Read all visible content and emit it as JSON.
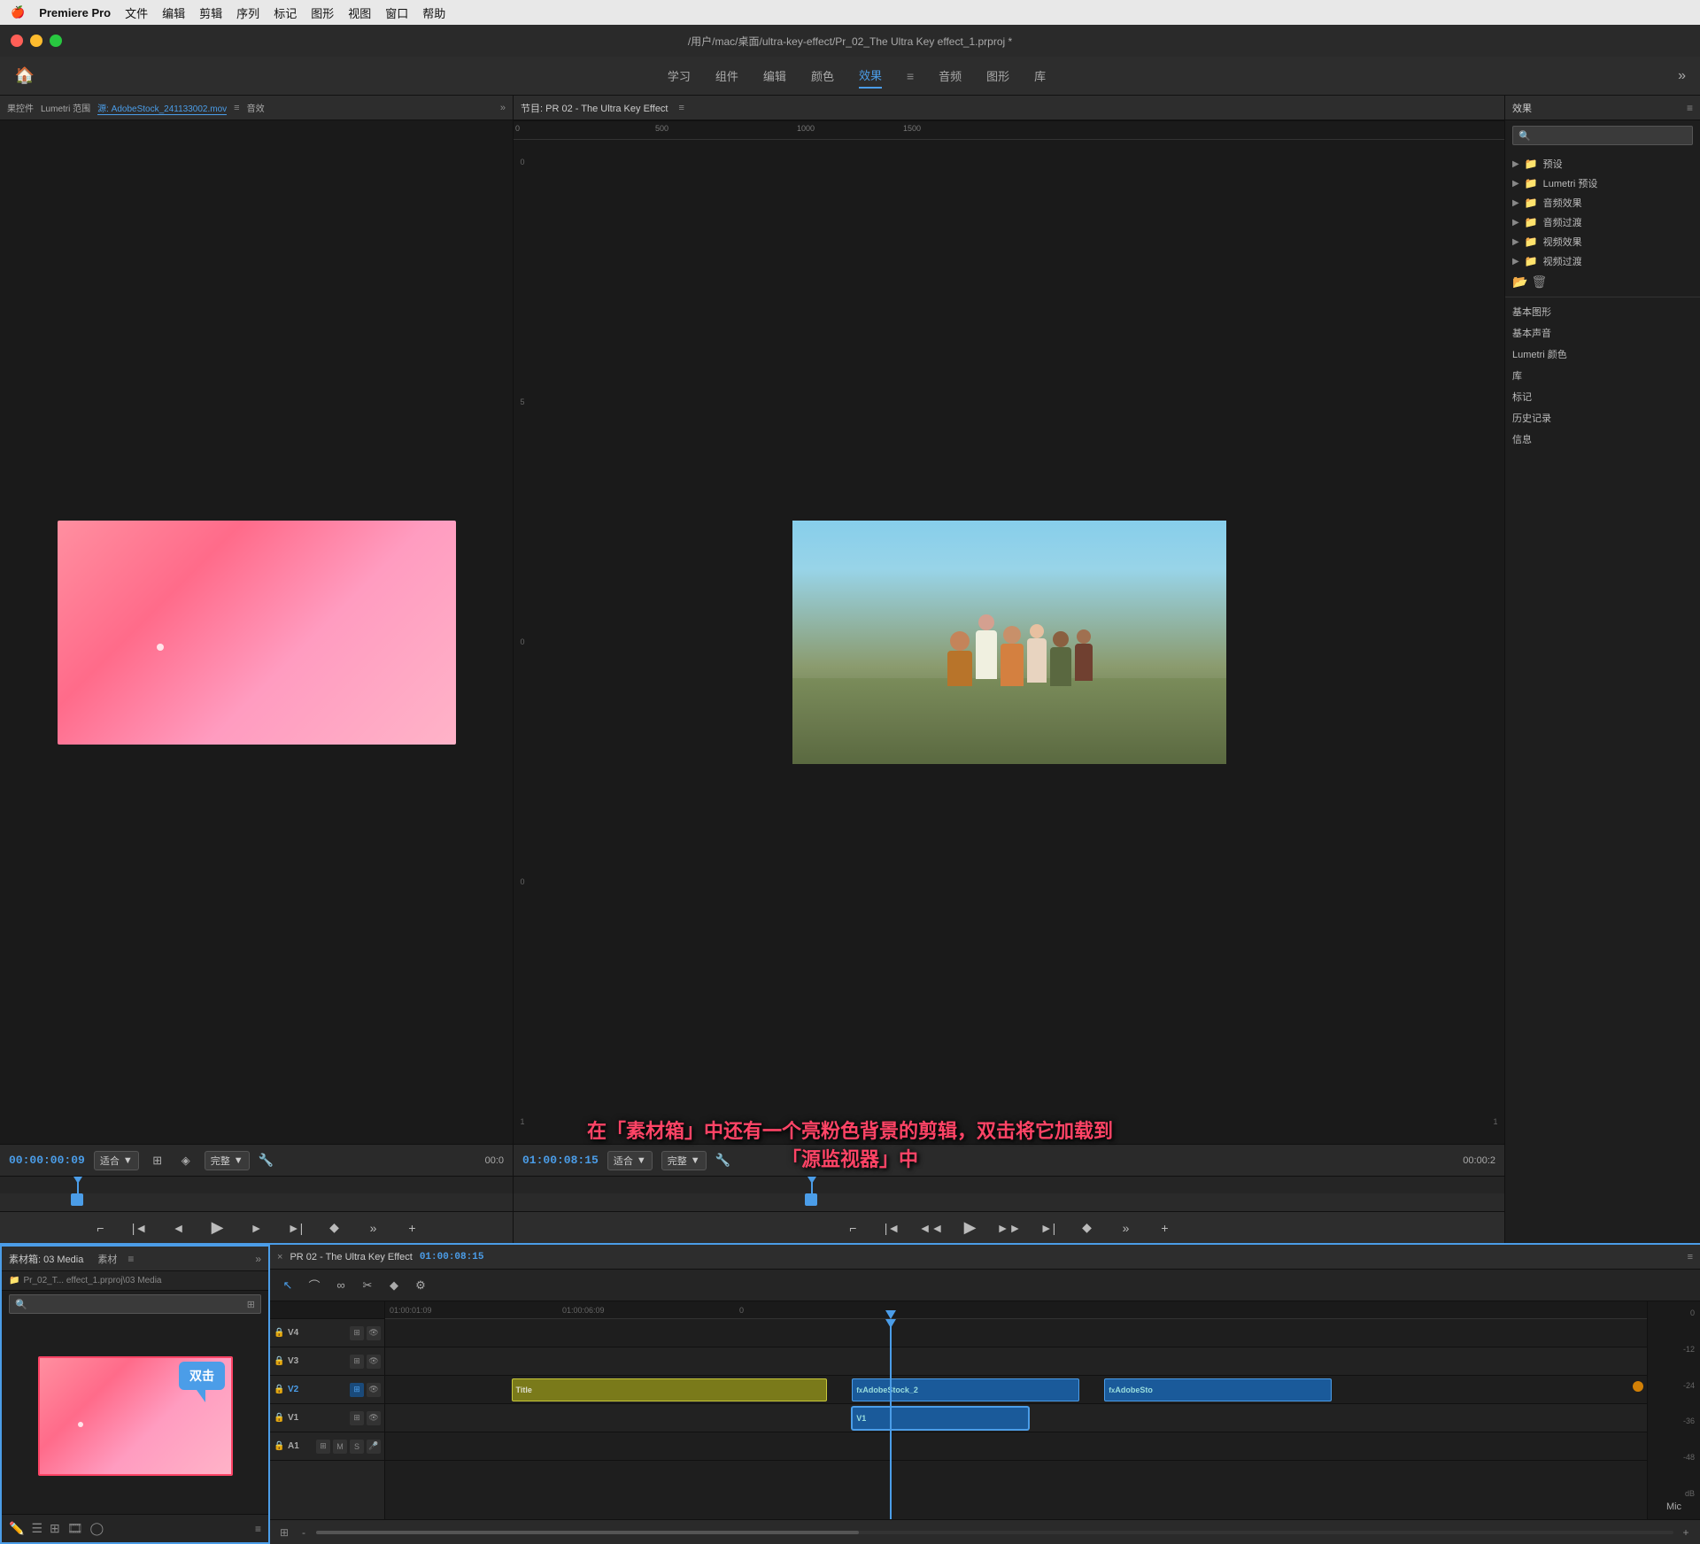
{
  "menubar": {
    "apple": "🍎",
    "app": "Premiere Pro",
    "items": [
      "文件",
      "编辑",
      "剪辑",
      "序列",
      "标记",
      "图形",
      "视图",
      "窗口",
      "帮助"
    ]
  },
  "titlebar": {
    "path": "/用户/mac/桌面/ultra-key-effect/Pr_02_The Ultra Key effect_1.prproj *"
  },
  "toolbar": {
    "items": [
      "学习",
      "组件",
      "编辑",
      "颜色",
      "效果",
      "音频",
      "图形",
      "库"
    ],
    "active": "效果",
    "more_icon": "»"
  },
  "source_monitor": {
    "panel_tabs": [
      "果控件",
      "Lumetri 范围"
    ],
    "source_tab": "源: AdobeStock_241133002.mov",
    "audio_tab": "音效",
    "timecode": "00:00:00:09",
    "fit": "适合",
    "quality": "完整",
    "time_right": "00:0",
    "transport": {
      "mark_in": "⌐",
      "go_to_in": "|◄",
      "prev_frame": "◄",
      "play": "▶",
      "next_frame": "►",
      "go_to_out": "►|",
      "add_marker": "◆",
      "more": "»",
      "add": "+"
    }
  },
  "program_monitor": {
    "title": "节目: PR 02 - The Ultra Key Effect",
    "ruler_labels": [
      "0",
      "500",
      "1000",
      "1500"
    ],
    "timecode": "01:00:08:15",
    "fit": "适合",
    "quality": "完整",
    "time_right": "00:00:2",
    "transport": {
      "mark_in": "⌐",
      "go_to_in": "|◄",
      "prev_frame": "◄◄",
      "play": "▶",
      "next_frame": "►►",
      "go_to_out": "►|",
      "add_marker": "◆",
      "more": "»",
      "add": "+"
    }
  },
  "effects_panel": {
    "title": "效果",
    "categories": [
      {
        "name": "预设",
        "has_arrow": true
      },
      {
        "name": "Lumetri 预设",
        "has_arrow": true
      },
      {
        "name": "音频效果",
        "has_arrow": true
      },
      {
        "name": "音频过渡",
        "has_arrow": true
      },
      {
        "name": "视频效果",
        "has_arrow": true
      },
      {
        "name": "视频过渡",
        "has_arrow": true
      }
    ],
    "sections": [
      {
        "name": "基本图形"
      },
      {
        "name": "基本声音"
      },
      {
        "name": "Lumetri 颜色"
      },
      {
        "name": "库"
      },
      {
        "name": "标记"
      },
      {
        "name": "历史记录"
      },
      {
        "name": "信息"
      }
    ]
  },
  "media_bin": {
    "title": "素材箱: 03 Media",
    "tab2": "素材",
    "path": "Pr_02_T... effect_1.prproj\\03 Media",
    "double_click_label": "双击"
  },
  "timeline": {
    "close": "×",
    "title": "PR 02 - The Ultra Key Effect",
    "timecode": "01:00:08:15",
    "ruler_labels": [
      "01:00:01:09",
      "01:00:06:09",
      "0"
    ],
    "tracks": [
      {
        "name": "V4",
        "has_lock": true,
        "clip": null
      },
      {
        "name": "V3",
        "has_lock": true,
        "clip": null
      },
      {
        "name": "V2",
        "has_lock": true,
        "clip": {
          "label": "AdobeStock_2",
          "type": "blue",
          "label2": "AdobeSto",
          "type2": "blue"
        }
      },
      {
        "name": "V1",
        "has_lock": true,
        "clip": {
          "label": "Title",
          "type": "yellow"
        }
      },
      {
        "name": "A1",
        "has_lock": true,
        "clip": null
      }
    ],
    "v1_clip": {
      "label": "V1",
      "type": "blue"
    },
    "playhead": "01:00:08:15"
  },
  "annotation": {
    "line1": "在「素材箱」中还有一个亮粉色背景的剪辑，双击将它加载到",
    "line2": "「源监视器」中"
  },
  "audio_meter": {
    "labels": [
      "0",
      "-12",
      "-24",
      "-36",
      "-48",
      "dB"
    ]
  },
  "mic_label": "Mic"
}
